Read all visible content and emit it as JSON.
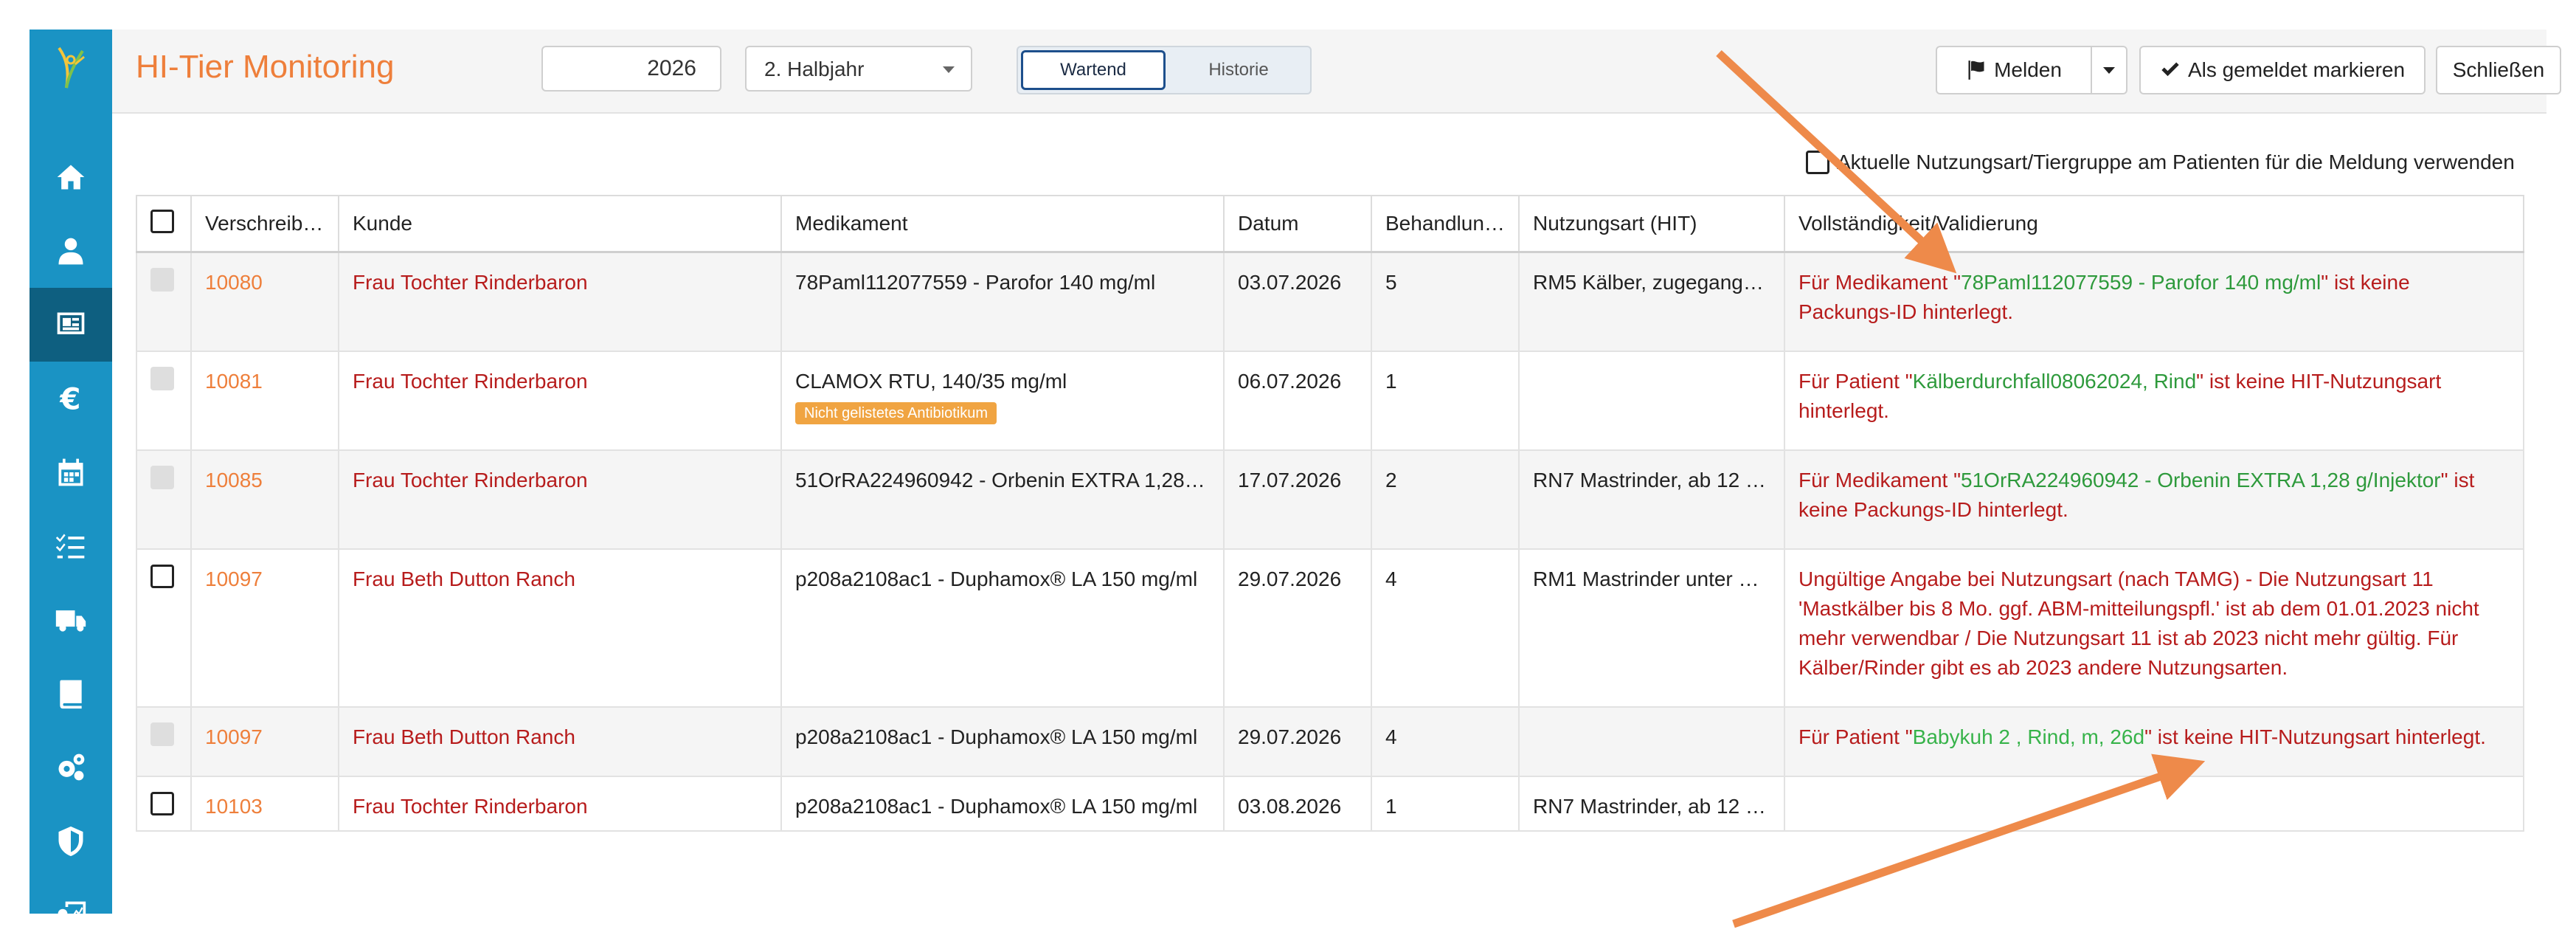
{
  "header": {
    "title": "HI-Tier Monitoring",
    "year": "2026",
    "half_selected": "2. Halbjahr",
    "view_toggle": [
      "Wartend",
      "Historie"
    ],
    "actions": {
      "report": "Melden",
      "mark_reported": "Als gemeldet markieren",
      "close": "Schließen"
    }
  },
  "sidebar": {
    "items": [
      {
        "icon": "home-icon"
      },
      {
        "icon": "doctor-icon"
      },
      {
        "icon": "monitor-icon",
        "active": true
      },
      {
        "icon": "euro-icon"
      },
      {
        "icon": "calendar-icon"
      },
      {
        "icon": "checklist-icon"
      },
      {
        "icon": "truck-icon"
      },
      {
        "icon": "book-icon"
      },
      {
        "icon": "gears-icon"
      },
      {
        "icon": "shield-icon"
      },
      {
        "icon": "user-chart-icon"
      }
    ]
  },
  "option": {
    "label": "Aktuelle Nutzungsart/Tiergruppe am Patienten für die Meldung verwenden"
  },
  "table": {
    "headers": [
      "Verschreib…",
      "Kunde",
      "Medikament",
      "Datum",
      "Behandlun…",
      "Nutzungsart (HIT)",
      "Vollständigkeit/Validierung"
    ],
    "rows": [
      {
        "id": "10080",
        "customer": "Frau Tochter Rinderbaron",
        "drug": "78Paml112077559 - Parofor 140 mg/ml",
        "badge": "",
        "date": "03.07.2026",
        "treatments": "5",
        "usage": "RM5 Kälber, zugegangen…",
        "msg_pre": "Für Medikament \"",
        "msg_hl": "78Paml112077559 - Parofor 140 mg/ml",
        "msg_post": "\" ist keine Packungs-ID hinterlegt.",
        "checkbox": "disabled"
      },
      {
        "id": "10081",
        "customer": "Frau Tochter Rinderbaron",
        "drug": "CLAMOX RTU, 140/35 mg/ml",
        "badge": "Nicht gelistetes Antibiotikum",
        "date": "06.07.2026",
        "treatments": "1",
        "usage": "",
        "msg_pre": "Für Patient \"",
        "msg_hl": "Kälberdurchfall08062024, Rind",
        "msg_post": "\" ist keine HIT-Nutzungsart hinterlegt.",
        "checkbox": "disabled"
      },
      {
        "id": "10085",
        "customer": "Frau Tochter Rinderbaron",
        "drug": "51OrRA224960942 - Orbenin EXTRA 1,28 g/…",
        "badge": "",
        "date": "17.07.2026",
        "treatments": "2",
        "usage": "RN7 Mastrinder, ab 12 M…",
        "msg_pre": "Für Medikament \"",
        "msg_hl": "51OrRA224960942 - Orbenin EXTRA 1,28 g/Injektor",
        "msg_post": "\" ist keine Packungs-ID hinterlegt.",
        "checkbox": "disabled"
      },
      {
        "id": "10097",
        "customer": "Frau Beth Dutton Ranch",
        "drug": "p208a2108ac1 - Duphamox® LA 150 mg/ml",
        "badge": "",
        "date": "29.07.2026",
        "treatments": "4",
        "usage": "RM1 Mastrinder unter 8 …",
        "msg_pre": "Ungültige Angabe bei Nutzungsart (nach TAMG) - Die Nutzungsart 11 'Mastkälber bis 8 Mo. ggf. ABM-mitteilungspfl.' ist ab dem 01.01.2023 nicht mehr verwendbar / Die Nutzungsart 11 ist ab 2023 nicht mehr gültig. Für Kälber/Rinder gibt es ab 2023 andere Nutzungsarten.",
        "msg_hl": "",
        "msg_post": "",
        "checkbox": "enabled"
      },
      {
        "id": "10097",
        "customer": "Frau Beth Dutton Ranch",
        "drug": "p208a2108ac1 - Duphamox® LA 150 mg/ml",
        "badge": "",
        "date": "29.07.2026",
        "treatments": "4",
        "usage": "",
        "msg_pre": "Für Patient \"",
        "msg_hl": "Babykuh 2 , Rind, m, 26d",
        "msg_post": "\" ist keine HIT-Nutzungsart hinterlegt.",
        "checkbox": "disabled"
      },
      {
        "id": "10103",
        "customer": "Frau Tochter Rinderbaron",
        "drug": "p208a2108ac1 - Duphamox® LA 150 mg/ml",
        "badge": "",
        "date": "03.08.2026",
        "treatments": "1",
        "usage": "RN7 Mastrinder, ab 12 M…",
        "msg_pre": "",
        "msg_hl": "",
        "msg_post": "",
        "checkbox": "enabled"
      }
    ]
  },
  "colors": {
    "sidebar": "#1a93c4",
    "sidebar_active": "#0e5f80",
    "accent": "#ee7f3b",
    "error": "#b71c1c",
    "highlight": "#2e9a3c",
    "badge": "#f0a442",
    "annotation_arrow": "#ee8a4a"
  }
}
